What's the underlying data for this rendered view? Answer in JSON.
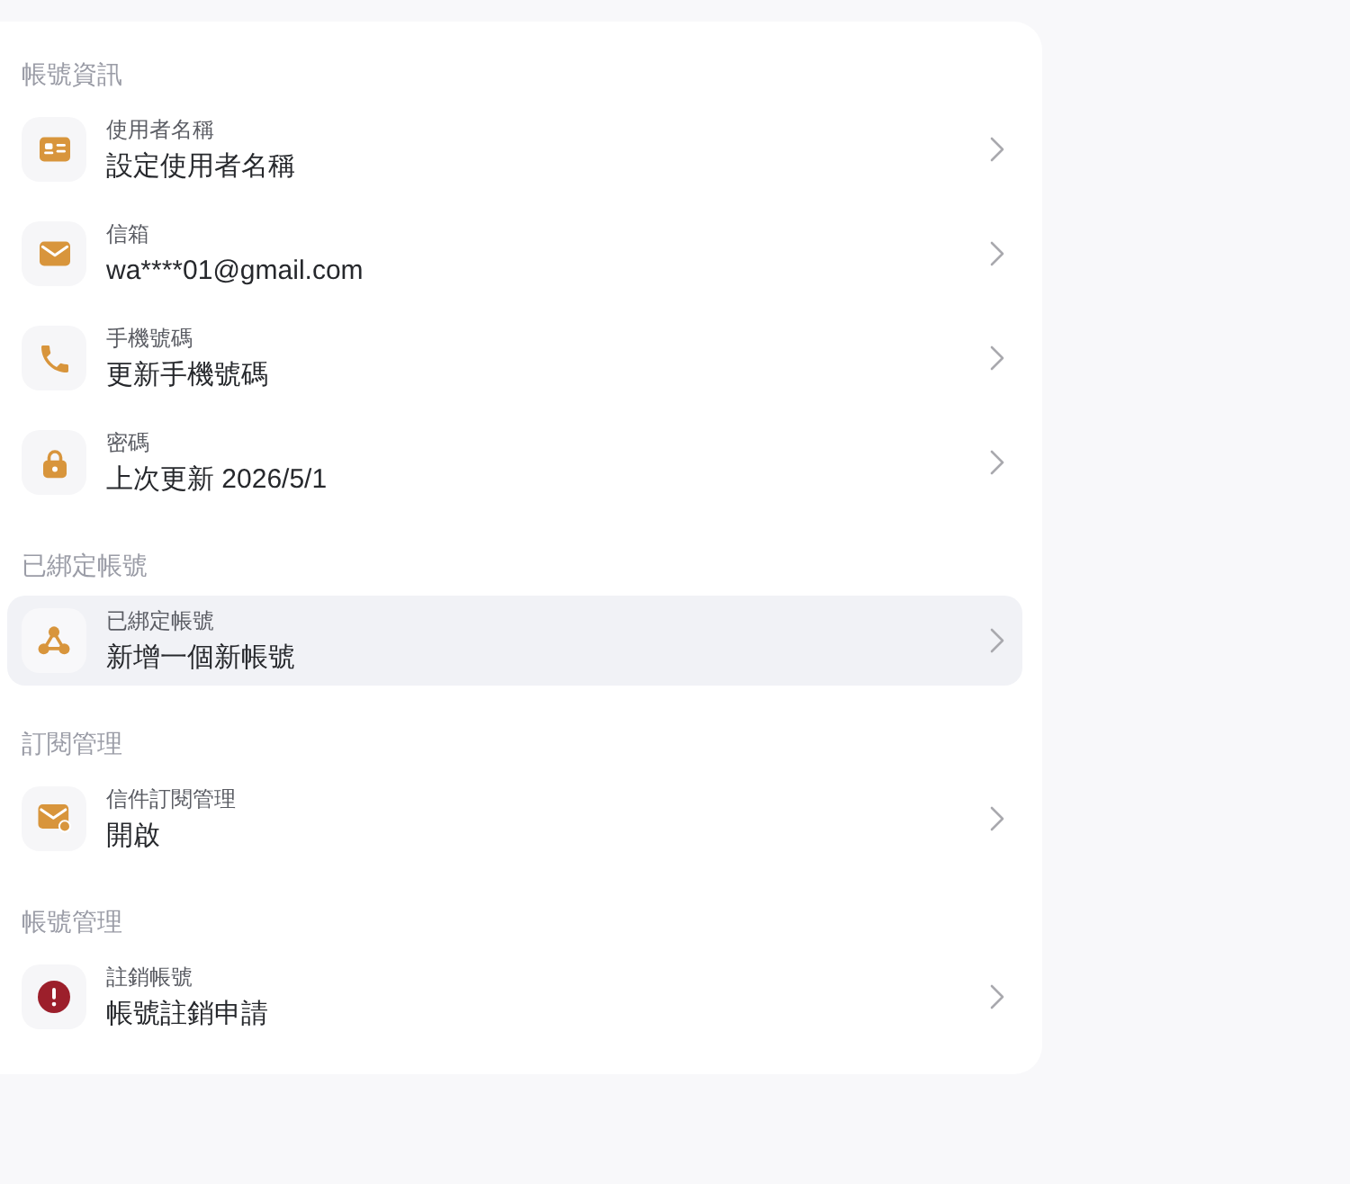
{
  "sections": [
    {
      "title": "帳號資訊",
      "items": [
        {
          "label": "使用者名稱",
          "value": "設定使用者名稱",
          "selected": false
        },
        {
          "label": "信箱",
          "value": "wa****01@gmail.com",
          "selected": false
        },
        {
          "label": "手機號碼",
          "value": "更新手機號碼",
          "selected": false
        },
        {
          "label": "密碼",
          "value": "上次更新 2026/5/1",
          "selected": false
        }
      ]
    },
    {
      "title": "已綁定帳號",
      "items": [
        {
          "label": "已綁定帳號",
          "value": "新增一個新帳號",
          "selected": true
        }
      ]
    },
    {
      "title": "訂閱管理",
      "items": [
        {
          "label": "信件訂閱管理",
          "value": "開啟",
          "selected": false
        }
      ]
    },
    {
      "title": "帳號管理",
      "items": [
        {
          "label": "註銷帳號",
          "value": "帳號註銷申請",
          "selected": false
        }
      ]
    }
  ]
}
